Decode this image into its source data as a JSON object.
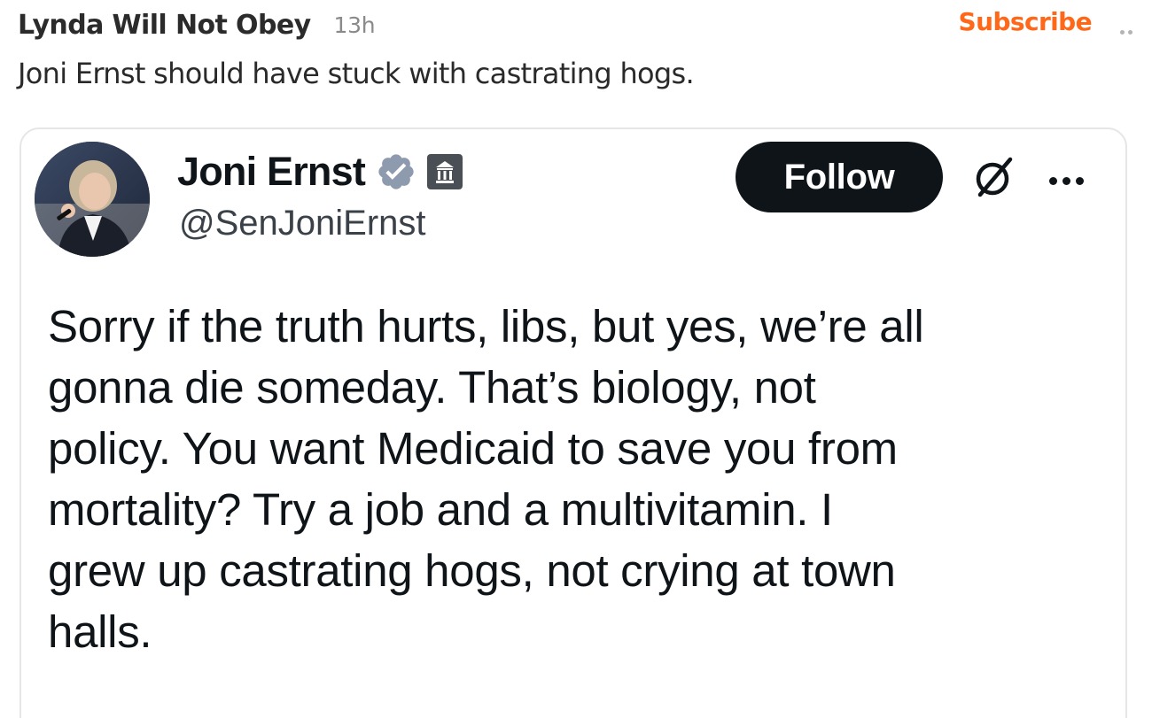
{
  "note": {
    "author": "Lynda Will Not Obey",
    "timestamp": "13h",
    "subscribe_label": "Subscribe",
    "menu_icon": "more-horizontal-icon",
    "text": "Joni Ernst should have stuck with castrating hogs."
  },
  "tweet": {
    "name": "Joni Ernst",
    "handle": "@SenJoniErnst",
    "verified_icon": "verified-badge-icon",
    "affiliation_icon": "government-building-icon",
    "follow_label": "Follow",
    "grok_icon": "grok-icon",
    "more_icon": "more-horizontal-icon",
    "text_lines": [
      "Sorry if the truth hurts, libs, but yes, we’re all",
      "gonna die someday. That’s biology, not",
      "policy. You want Medicaid to save you from",
      "mortality? Try a job and a multivitamin. I",
      "grew up castrating hogs, not crying at town",
      "halls."
    ]
  },
  "colors": {
    "accent": "#ff6719",
    "follow_bg": "#0f1419",
    "verified": "#8e9aad",
    "meta_gray": "#8a8a8a"
  }
}
